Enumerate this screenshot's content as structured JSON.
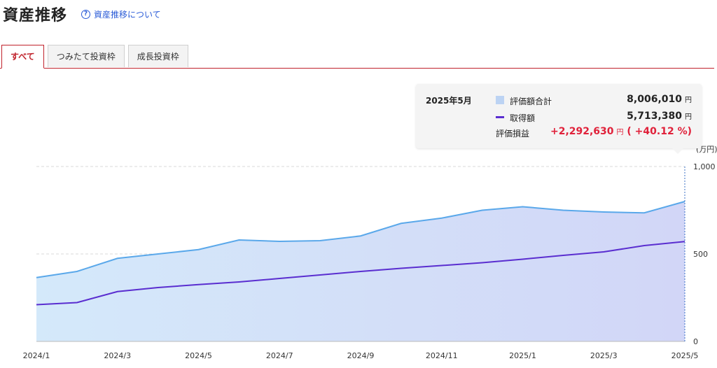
{
  "header": {
    "title": "資産推移",
    "help_label": "資産推移について",
    "help_icon_glyph": "?"
  },
  "tabs": [
    {
      "label": "すべて",
      "active": true
    },
    {
      "label": "つみたて投資枠",
      "active": false
    },
    {
      "label": "成長投資枠",
      "active": false
    }
  ],
  "tooltip": {
    "date": "2025年5月",
    "rows": [
      {
        "label": "評価額合計",
        "value": "8,006,010",
        "unit": "円"
      },
      {
        "label": "取得額",
        "value": "5,713,380",
        "unit": "円"
      },
      {
        "label": "評価損益",
        "value": "+2,292,630",
        "unit": "円",
        "extra": "( +40.12 %)"
      }
    ]
  },
  "colors": {
    "accent": "#c0222b",
    "gain": "#e0213a",
    "area_line": "#5aa8ea",
    "cost_line": "#5a2ed0",
    "link": "#2a5bd7"
  },
  "chart_data": {
    "type": "area",
    "yunit": "(万円)",
    "ylim": [
      0,
      1000
    ],
    "yticks": [
      0,
      500,
      1000
    ],
    "x": [
      "2024/1",
      "2024/2",
      "2024/3",
      "2024/4",
      "2024/5",
      "2024/6",
      "2024/7",
      "2024/8",
      "2024/9",
      "2024/10",
      "2024/11",
      "2024/12",
      "2025/1",
      "2025/2",
      "2025/3",
      "2025/4",
      "2025/5"
    ],
    "xtick_labels": [
      "2024/1",
      "2024/3",
      "2024/5",
      "2024/7",
      "2024/9",
      "2024/11",
      "2025/1",
      "2025/3",
      "2025/5"
    ],
    "series": [
      {
        "name": "評価額合計",
        "values": [
          365,
          400,
          475,
          500,
          525,
          580,
          572,
          576,
          603,
          675,
          705,
          750,
          770,
          750,
          740,
          735,
          800
        ]
      },
      {
        "name": "取得額",
        "values": [
          210,
          222,
          285,
          308,
          325,
          340,
          360,
          380,
          400,
          418,
          434,
          450,
          470,
          492,
          512,
          548,
          571
        ]
      }
    ]
  }
}
